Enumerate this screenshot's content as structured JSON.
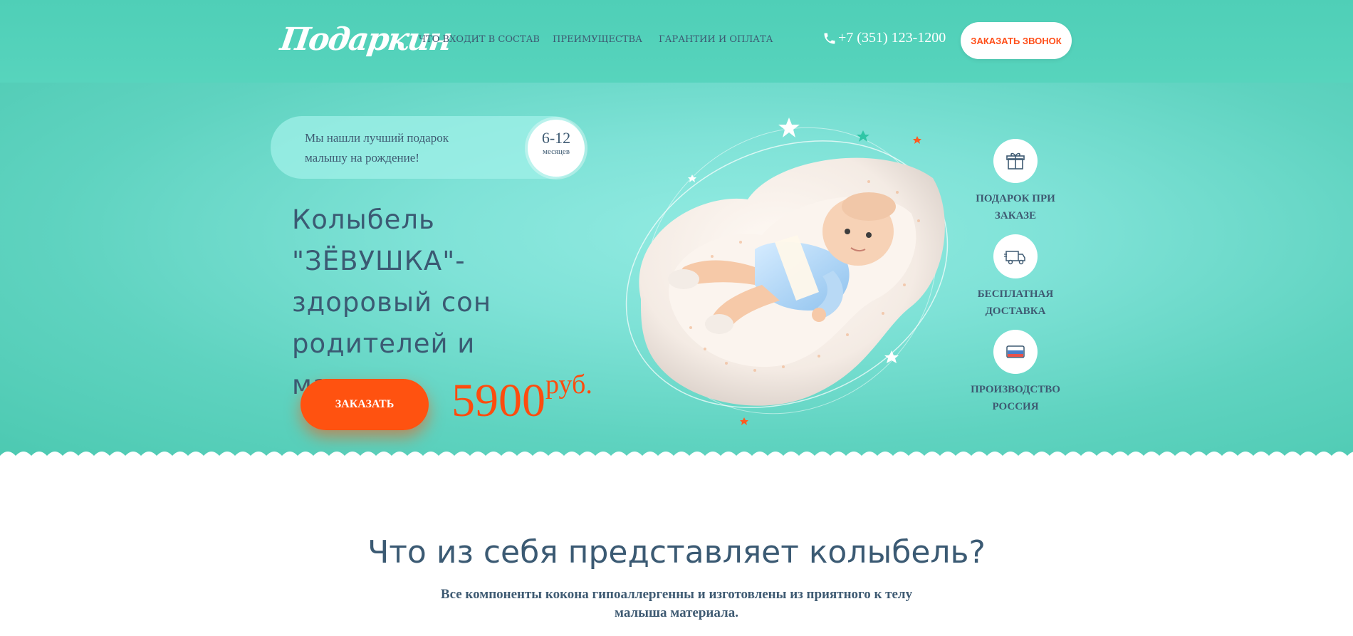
{
  "header": {
    "logo": "Подаркин",
    "nav": [
      "ЧТО ВХОДИТ В СОСТАВ",
      "ПРЕИМУЩЕСТВА",
      "ГАРАНТИИ И ОПЛАТА"
    ],
    "phone": "+7 (351) 123-1200",
    "callback_label": "ЗАКАЗАТЬ ЗВОНОК"
  },
  "hero": {
    "tagline": "Мы нашли лучший подарок малышу на рождение!",
    "age_range": "6-12",
    "age_unit": "месяцев",
    "title": "Колыбель \"ЗЁВУШКА\"- здоровый сон родителей и малыша.",
    "order_label": "ЗАКАЗАТЬ",
    "price": "5900",
    "currency": "руб."
  },
  "features": [
    {
      "icon": "gift-icon",
      "label": "ПОДАРОК ПРИ ЗАКАЗЕ"
    },
    {
      "icon": "truck-icon",
      "label": "БЕСПЛАТНАЯ ДОСТАВКА"
    },
    {
      "icon": "russia-flag-icon",
      "label": "ПРОИЗВОДСТВО РОССИЯ"
    }
  ],
  "section": {
    "title": "Что из себя представляет колыбель?",
    "subtitle": "Все компоненты кокона гипоаллергенны и изготовлены из приятного к телу малыша материала."
  },
  "colors": {
    "accent": "#ff5210",
    "teal": "#57d4bd",
    "text": "#3b5a73"
  }
}
